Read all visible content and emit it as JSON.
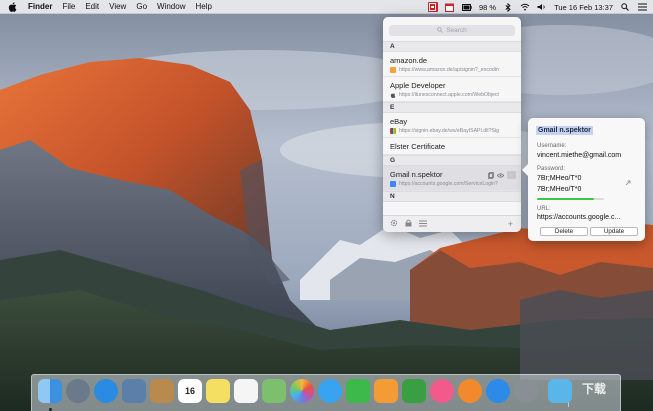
{
  "menubar": {
    "app_name": "Finder",
    "items": [
      "File",
      "Edit",
      "View",
      "Go",
      "Window",
      "Help"
    ],
    "battery": "98 %",
    "clock": "Tue 16 Feb  13:37",
    "status_icons": [
      "password-manager-icon",
      "calendar-icon",
      "battery-icon",
      "bluetooth-icon",
      "wifi-icon",
      "volume-icon",
      "spotlight-icon",
      "notification-center-icon"
    ]
  },
  "popover": {
    "search_placeholder": "Search",
    "sections": [
      {
        "letter": "A",
        "entries": [
          {
            "title": "amazon.de",
            "url": "https://www.amazon.de/ap/signin?_encodin",
            "favicon": "amazon-icon",
            "color": "#f2a33a"
          },
          {
            "title": "Apple Developer",
            "url": "https://itunesconnect.apple.com/WebObject",
            "favicon": "apple-icon",
            "color": ""
          }
        ]
      },
      {
        "letter": "E",
        "entries": [
          {
            "title": "eBay",
            "url": "https://signin.ebay.de/ws/eBayISAPI.dll?Sig",
            "favicon": "ebay-icon",
            "color": "#e53238"
          },
          {
            "title": "Elster Certificate",
            "url": "",
            "favicon": "",
            "color": ""
          }
        ]
      },
      {
        "letter": "G",
        "entries": [
          {
            "title": "Gmail n.spektor",
            "url": "https://accounts.google.com/ServiceLogin?",
            "favicon": "google-icon",
            "color": "#4285f4",
            "selected": true
          }
        ]
      },
      {
        "letter": "N",
        "entries": []
      }
    ],
    "footer_icons": [
      "settings-icon",
      "lock-icon",
      "list-icon"
    ],
    "add_label": "+"
  },
  "detail": {
    "title": "Gmail n.spektor",
    "username_label": "Username:",
    "username": "vincent.miethe@gmail.com",
    "password_label": "Password:",
    "password_line1": "7Br;MHeo/T*0",
    "password_line2": "7Br;MHeo/T*0",
    "password_strength": 0.85,
    "strength_color": "#3bc84a",
    "url_label": "URL:",
    "url": "https://accounts.google.c...",
    "delete_label": "Delete",
    "update_label": "Update"
  },
  "dock": {
    "apps": [
      {
        "name": "finder",
        "icon": "finder-icon",
        "color": "#3d8fe0"
      },
      {
        "name": "launchpad",
        "icon": "launchpad-icon",
        "color": "#6b7a8a"
      },
      {
        "name": "safari",
        "icon": "safari-icon",
        "color": "#2b8ae2"
      },
      {
        "name": "preview-photo",
        "icon": "photo-icon",
        "color": "#5b7fa8"
      },
      {
        "name": "contacts",
        "icon": "contacts-icon",
        "color": "#b88a4e"
      },
      {
        "name": "calendar",
        "icon": "calendar-icon",
        "color": "#ffffff",
        "label": "16"
      },
      {
        "name": "notes",
        "icon": "notes-icon",
        "color": "#f4df62"
      },
      {
        "name": "reminders",
        "icon": "reminders-icon",
        "color": "#f5f5f5"
      },
      {
        "name": "maps",
        "icon": "maps-icon",
        "color": "#7cbf6c"
      },
      {
        "name": "photos",
        "icon": "photos-icon",
        "color": "#f0f0f0"
      },
      {
        "name": "messages",
        "icon": "messages-icon",
        "color": "#38a3f0"
      },
      {
        "name": "facetime",
        "icon": "facetime-icon",
        "color": "#3cb94a"
      },
      {
        "name": "pages",
        "icon": "pages-icon",
        "color": "#f39b34"
      },
      {
        "name": "numbers",
        "icon": "numbers-icon",
        "color": "#3a9e43"
      },
      {
        "name": "itunes",
        "icon": "itunes-icon",
        "color": "#f25a8c"
      },
      {
        "name": "ibooks",
        "icon": "ibooks-icon",
        "color": "#f08a2c"
      },
      {
        "name": "app-store",
        "icon": "app-store-icon",
        "color": "#2d8ae8"
      },
      {
        "name": "system-preferences",
        "icon": "system-preferences-icon",
        "color": "#8a8f96"
      },
      {
        "name": "folder",
        "icon": "folder-icon",
        "color": "#5ab6e8"
      }
    ],
    "watermark": "下载"
  }
}
